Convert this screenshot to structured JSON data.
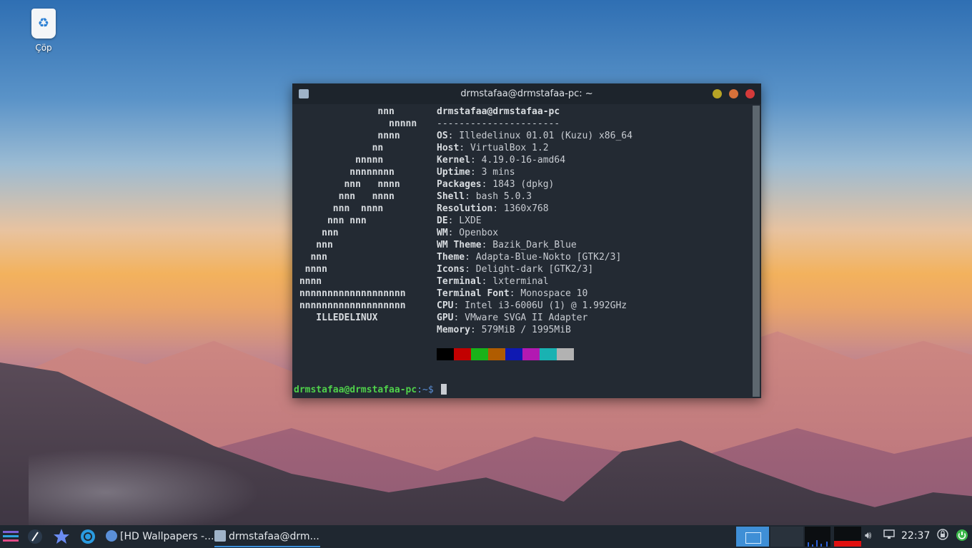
{
  "desktop": {
    "trash_label": "Çöp"
  },
  "window": {
    "title": "drmstafaa@drmstafaa-pc: ~"
  },
  "neofetch": {
    "logo": [
      "               nnn",
      "                 nnnnn",
      "               nnnn",
      "              nn",
      "           nnnnn",
      "          nnnnnnnn",
      "         nnn   nnnn",
      "        nnn   nnnn",
      "       nnn  nnnn",
      "      nnn nnn",
      "     nnn",
      "    nnn",
      "   nnn",
      "  nnnn",
      " nnnn",
      " nnnnnnnnnnnnnnnnnnn",
      " nnnnnnnnnnnnnnnnnnn",
      "    ILLEDELINUX"
    ],
    "header": "drmstafaa@drmstafaa-pc",
    "separator": "----------------------",
    "info": [
      {
        "key": "OS",
        "value": "Illedelinux 01.01 (Kuzu) x86_64"
      },
      {
        "key": "Host",
        "value": "VirtualBox 1.2"
      },
      {
        "key": "Kernel",
        "value": "4.19.0-16-amd64"
      },
      {
        "key": "Uptime",
        "value": "3 mins"
      },
      {
        "key": "Packages",
        "value": "1843 (dpkg)"
      },
      {
        "key": "Shell",
        "value": "bash 5.0.3"
      },
      {
        "key": "Resolution",
        "value": "1360x768"
      },
      {
        "key": "DE",
        "value": "LXDE"
      },
      {
        "key": "WM",
        "value": "Openbox"
      },
      {
        "key": "WM Theme",
        "value": "Bazik_Dark_Blue"
      },
      {
        "key": "Theme",
        "value": "Adapta-Blue-Nokto [GTK2/3]"
      },
      {
        "key": "Icons",
        "value": "Delight-dark [GTK2/3]"
      },
      {
        "key": "Terminal",
        "value": "lxterminal"
      },
      {
        "key": "Terminal Font",
        "value": "Monospace 10"
      },
      {
        "key": "CPU",
        "value": "Intel i3-6006U (1) @ 1.992GHz"
      },
      {
        "key": "GPU",
        "value": "VMware SVGA II Adapter"
      },
      {
        "key": "Memory",
        "value": "579MiB / 1995MiB"
      }
    ],
    "palette": [
      "#000000",
      "#c20000",
      "#19b219",
      "#b05c00",
      "#0f19b2",
      "#b219b2",
      "#19b2b2",
      "#b2b2b2"
    ]
  },
  "prompt": {
    "userhost": "drmstafaa@drmstafaa-pc",
    "path": ":~",
    "symbol": "$"
  },
  "taskbar": {
    "tasks": [
      {
        "label": "[HD Wallpapers -..."
      },
      {
        "label": "drmstafaa@drm..."
      }
    ],
    "clock": "22:37",
    "memory_usage_fraction": 0.29
  }
}
